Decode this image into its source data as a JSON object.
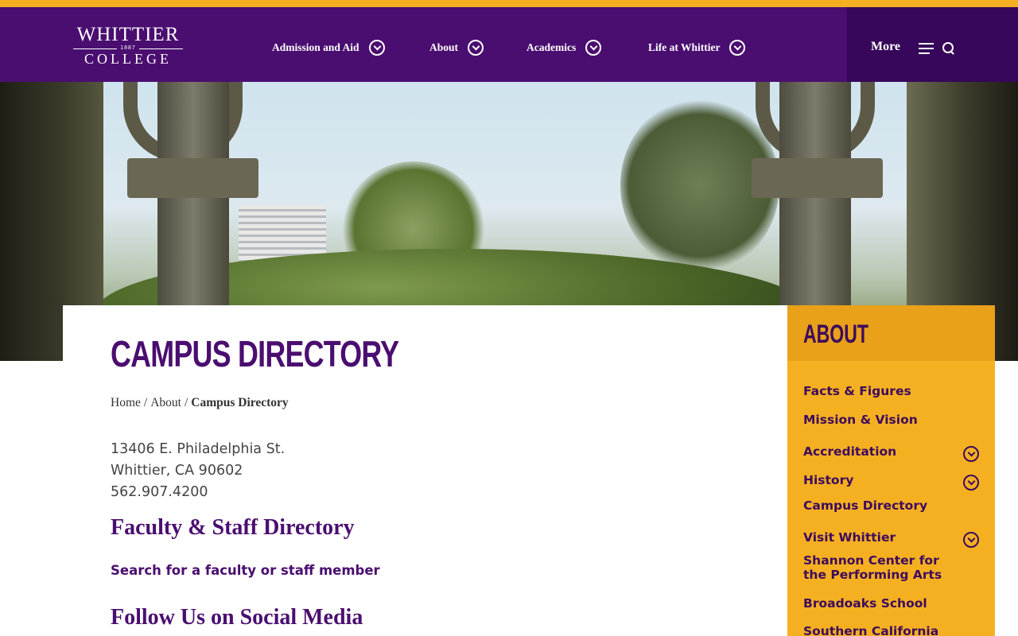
{
  "header": {
    "logo_top": "WHITTIER",
    "logo_year": "1887",
    "logo_bottom": "COLLEGE",
    "nav": [
      {
        "label": "Admission and Aid"
      },
      {
        "label": "About"
      },
      {
        "label": "Academics"
      },
      {
        "label": "Life at Whittier"
      }
    ],
    "more_label": "More"
  },
  "colors": {
    "brand_purple": "#4a0e70",
    "brand_gold": "#f5b021",
    "dark_purple": "#36075a"
  },
  "main": {
    "title": "CAMPUS DIRECTORY",
    "breadcrumb": {
      "home": "Home",
      "separator": "/",
      "about": "About",
      "current": "Campus Directory"
    },
    "address": {
      "street": "13406 E. Philadelphia St.",
      "city": "Whittier, CA 90602",
      "phone": "562.907.4200"
    },
    "faculty_heading": "Faculty & Staff Directory",
    "search_link": "Search for a faculty or staff member",
    "social_heading": "Follow Us on Social Media"
  },
  "sidebar": {
    "title": "ABOUT",
    "items": [
      {
        "label": "Facts & Figures",
        "expandable": false
      },
      {
        "label": "Mission & Vision",
        "expandable": false
      },
      {
        "label": "Accreditation",
        "expandable": true
      },
      {
        "label": "History",
        "expandable": true
      },
      {
        "label": "Campus Directory",
        "expandable": false
      },
      {
        "label": "Visit Whittier",
        "expandable": true
      },
      {
        "label": "Shannon Center for the Performing Arts",
        "expandable": false
      },
      {
        "label": "Broadoaks School",
        "expandable": false
      },
      {
        "label": "Southern California",
        "expandable": false
      }
    ]
  }
}
